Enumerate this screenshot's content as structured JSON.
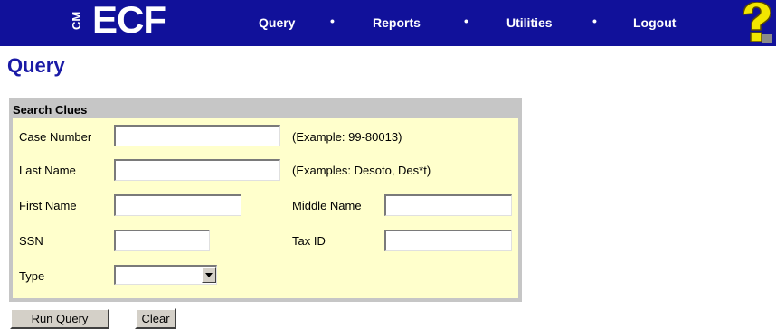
{
  "header": {
    "logo_prefix": "CM",
    "logo_text": "ECF",
    "nav": {
      "query": "Query",
      "reports": "Reports",
      "utilities": "Utilities",
      "logout": "Logout",
      "separator": "•"
    },
    "help_icon": "question-mark-icon"
  },
  "page": {
    "title": "Query"
  },
  "search": {
    "header": "Search Clues",
    "case_number": {
      "label": "Case Number",
      "value": "",
      "hint": "(Example: 99-80013)"
    },
    "last_name": {
      "label": "Last Name",
      "value": "",
      "hint": "(Examples: Desoto, Des*t)"
    },
    "first_name": {
      "label": "First Name",
      "value": ""
    },
    "middle_name": {
      "label": "Middle Name",
      "value": ""
    },
    "ssn": {
      "label": "SSN",
      "value": ""
    },
    "tax_id": {
      "label": "Tax ID",
      "value": ""
    },
    "type": {
      "label": "Type",
      "selected": ""
    }
  },
  "buttons": {
    "run_query": "Run Query",
    "clear": "Clear"
  },
  "colors": {
    "nav_bar": "#11119a",
    "title": "#1a1aa6",
    "panel_border": "#c6c6c6",
    "panel_body": "#ffffcc",
    "help_icon": "#f2e600"
  }
}
